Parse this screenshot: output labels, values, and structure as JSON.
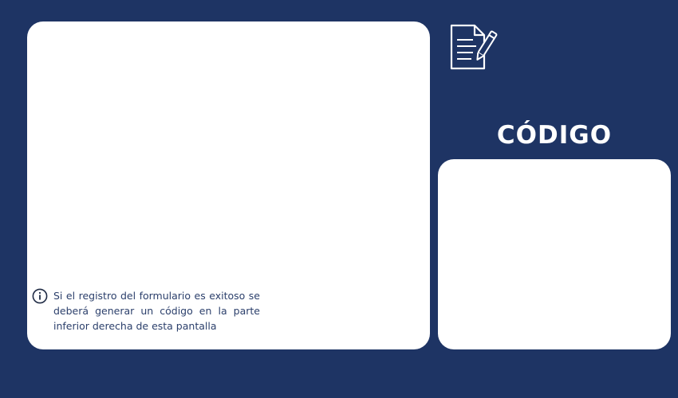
{
  "form_panel": {
    "info_icon": "info-circle-icon",
    "info_text": "Si el registro del formulario es exitoso se deberá generar un código en la parte inferior derecha de esta pantalla"
  },
  "code_section": {
    "icon": "document-edit-icon",
    "title": "CÓDIGO"
  },
  "colors": {
    "background": "#1e3464",
    "panel": "#ffffff",
    "info_text": "#2b3f6b"
  }
}
